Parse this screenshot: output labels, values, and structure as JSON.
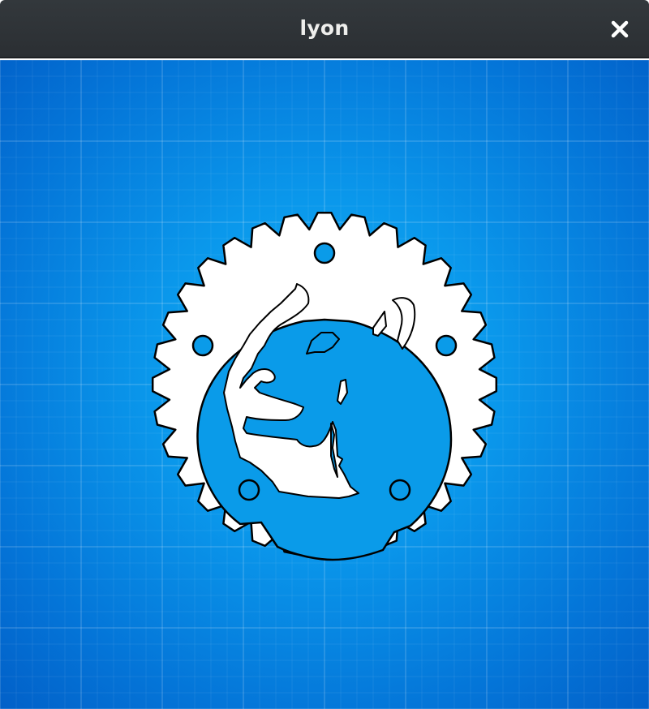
{
  "window": {
    "title": "lyon"
  },
  "icons": {
    "close": "close-icon",
    "logo": "rust-logo-icon"
  },
  "colors": {
    "titlebar": "#2e3236",
    "title_text": "#eeeeec",
    "canvas_center": "#12b2f6",
    "canvas_edge": "#0260c8",
    "logo_fill": "#ffffff",
    "logo_stroke": "#000000"
  }
}
